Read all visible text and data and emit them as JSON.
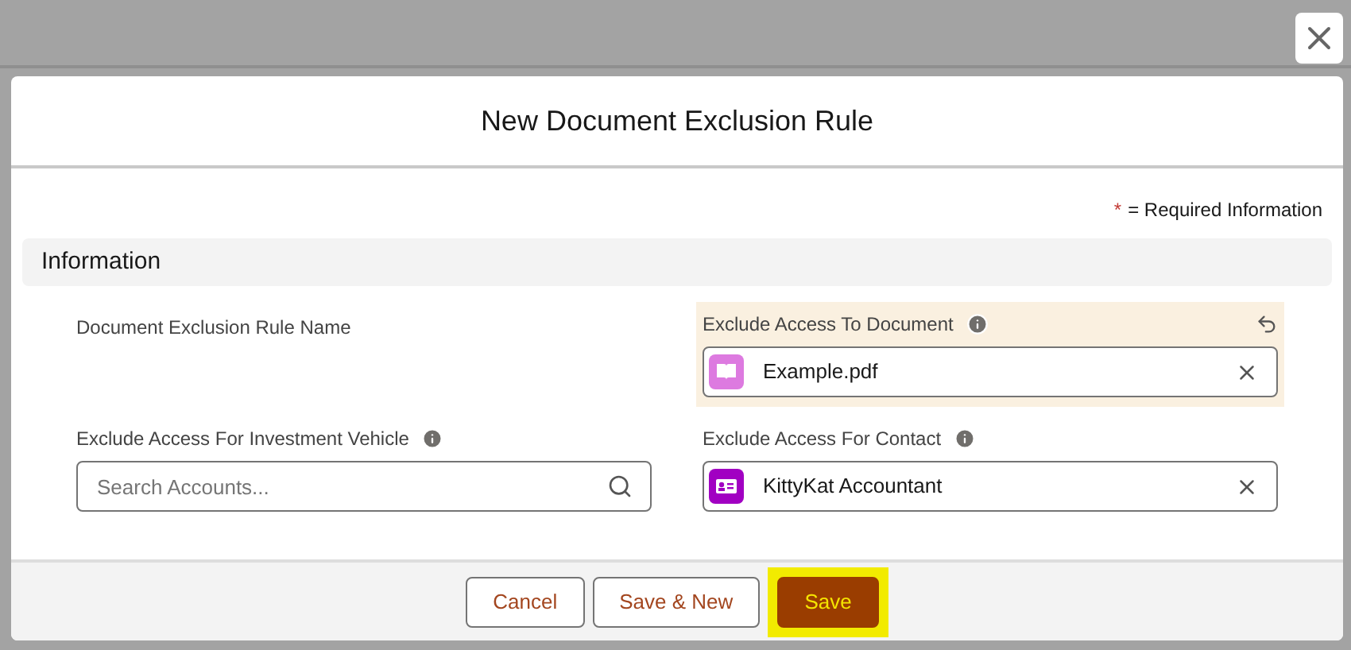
{
  "modal": {
    "title": "New Document Exclusion Rule",
    "required_note": {
      "mark": "*",
      "text": "= Required Information"
    },
    "section": {
      "title": "Information"
    },
    "fields": [
      {
        "kind": "readonly",
        "label": "Document Exclusion Rule Name",
        "info": false,
        "edited": false
      },
      {
        "kind": "lookup",
        "label": "Exclude Access To Document",
        "info": true,
        "edited": true,
        "value": "Example.pdf",
        "record": {
          "kind": "document",
          "color": "#dd7ae0"
        }
      },
      {
        "kind": "search",
        "label": "Exclude Access For Investment Vehicle",
        "info": true,
        "edited": false,
        "placeholder": "Search Accounts..."
      },
      {
        "kind": "lookup",
        "label": "Exclude Access For Contact",
        "info": true,
        "edited": false,
        "value": "KittyKat Accountant",
        "record": {
          "kind": "contact",
          "color": "#a100c2"
        }
      }
    ],
    "buttons": [
      {
        "label": "Cancel",
        "kind": "neutral"
      },
      {
        "label": "Save & New",
        "kind": "neutral"
      },
      {
        "label": "Save",
        "kind": "brand",
        "highlighted": true
      }
    ]
  }
}
